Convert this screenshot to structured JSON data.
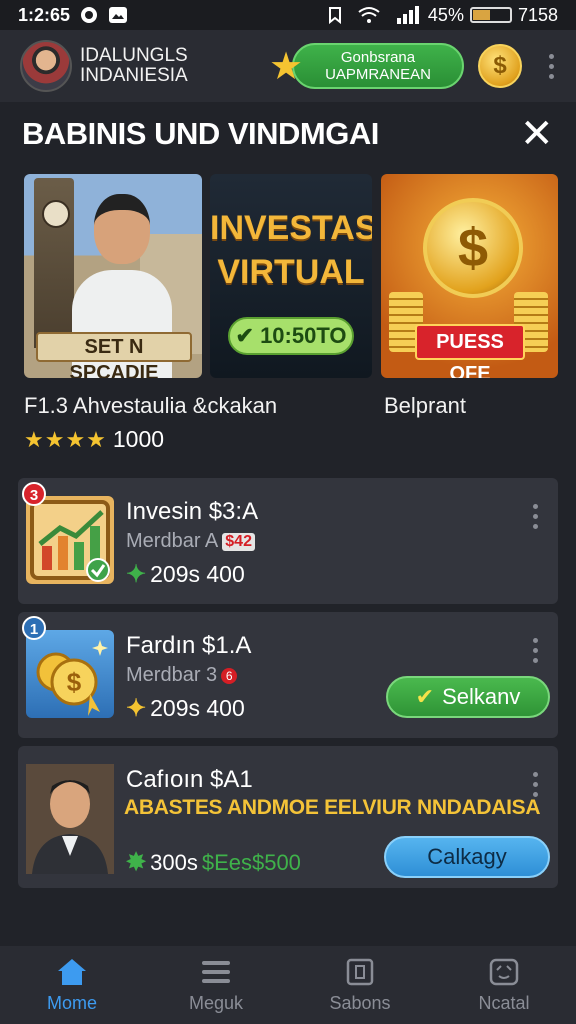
{
  "status_bar": {
    "time": "1:2:65",
    "battery_text": "45%",
    "extra_text": "7158",
    "battery_level": 0.45
  },
  "header": {
    "brand_line1": "IDALUNGLS",
    "brand_line2": "INDANIESIA",
    "pill_line1": "Gonbsrana",
    "pill_line2": "UAPMRANEAN",
    "coin_symbol": "$"
  },
  "section": {
    "title": "BABINIS UND VINDMGAI",
    "close_glyph": "✕"
  },
  "banners": {
    "b1_label": "SET N SPCADIE",
    "b2_line1": "INVESTASI",
    "b2_line2": "VIRTUAL",
    "b2_time": "10:50TO",
    "b3_coin": "$",
    "b3_label": "PUESS OFE"
  },
  "featured": {
    "caption_left": "F1.3 Ahvestaulia &ckakan",
    "caption_right": "Belprant",
    "stars": "★★★★",
    "rating_count": "1000"
  },
  "cards": [
    {
      "badge": "3",
      "title": "Invesin $3:A",
      "sub": "Merdbar A",
      "sub_tag": "$42",
      "stat": "209s 400"
    },
    {
      "badge": "1",
      "title": "Fardın $1.A",
      "sub": "Merdbar 3",
      "sub_dot": "6",
      "stat": "209s 400",
      "button": "Selkanv"
    },
    {
      "title": "Cafıoın $A1",
      "promo": "ABASTES ANDMOE EELVIUR NNDADAISA",
      "stat_a": "300s",
      "stat_b": "$Ees$500",
      "button": "Calkagy"
    }
  ],
  "nav": [
    {
      "label": "Mome",
      "icon": "home-icon"
    },
    {
      "label": "Meguk",
      "icon": "menu-icon"
    },
    {
      "label": "Sabons",
      "icon": "document-icon"
    },
    {
      "label": "Ncatal",
      "icon": "profile-icon"
    }
  ],
  "colors": {
    "accent_blue": "#3d9bf0",
    "green": "#3fb24a",
    "gold": "#f5c431",
    "background": "#212329"
  }
}
